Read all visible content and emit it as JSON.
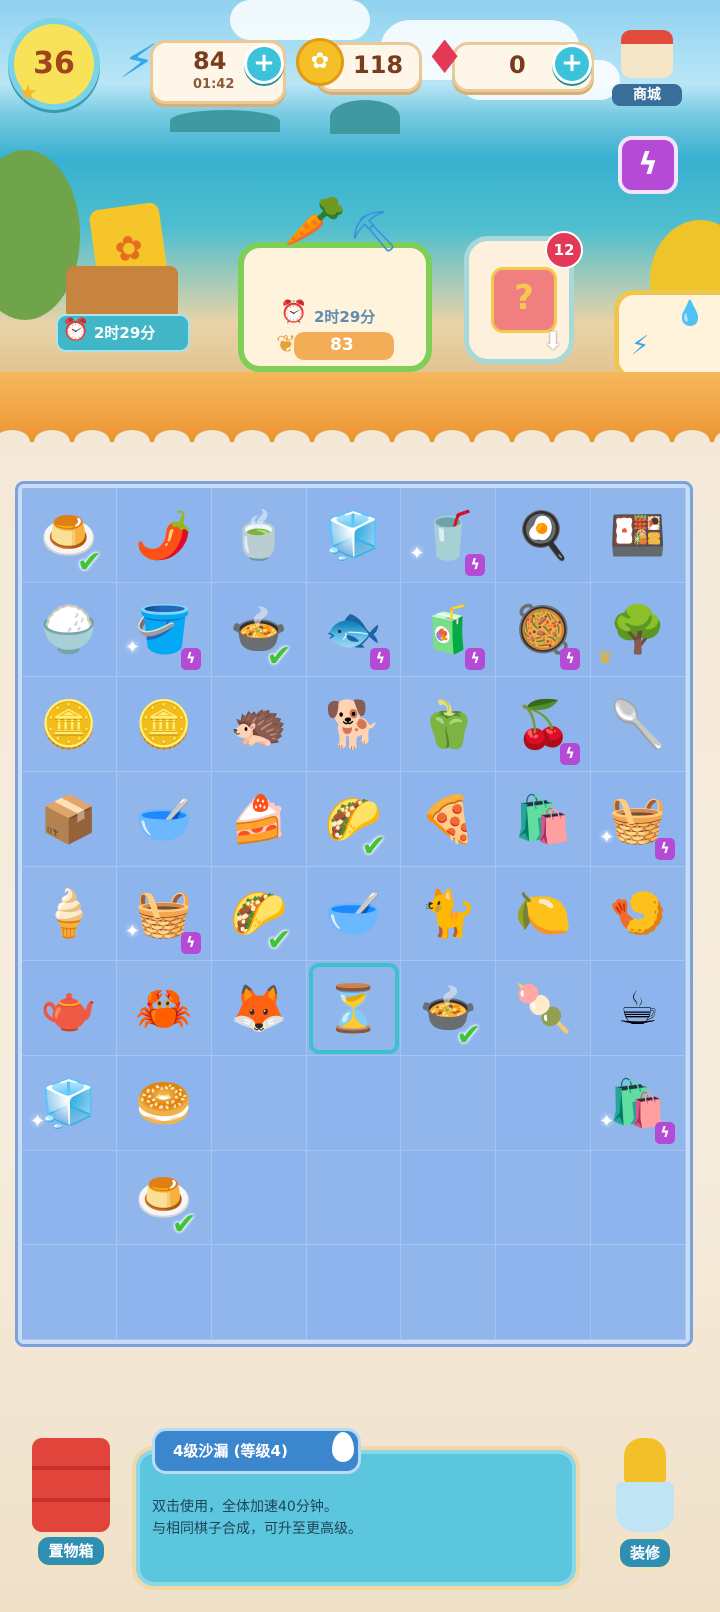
{
  "hud": {
    "level": "36",
    "energy_value": "84",
    "energy_timer": "01:42",
    "coins_value": "118",
    "gems_value": "0",
    "shop_label": "商城",
    "plus_symbol": "+"
  },
  "tasks": {
    "crate_timer": "2时29分",
    "garden_timer": "2时29分",
    "garden_count": "83",
    "chest_badge": "12"
  },
  "board": {
    "items": [
      {
        "icon": "🍮",
        "name": "steamed-bun",
        "check": true
      },
      {
        "icon": "🌶️",
        "name": "green-chili"
      },
      {
        "icon": "🍵",
        "name": "lemon-tea"
      },
      {
        "icon": "🧊",
        "name": "ice-box"
      },
      {
        "icon": "🥤",
        "name": "juicer",
        "sparkle": true,
        "bolt": true
      },
      {
        "icon": "🍳",
        "name": "frying-pan"
      },
      {
        "icon": "🍱",
        "name": "bento"
      },
      {
        "icon": "🍚",
        "name": "fried-rice"
      },
      {
        "icon": "🪣",
        "name": "bucket",
        "sparkle": true,
        "bolt": true
      },
      {
        "icon": "🍲",
        "name": "soup-bowl",
        "check": true
      },
      {
        "icon": "🐟",
        "name": "fish-bowl",
        "bolt": true
      },
      {
        "icon": "🧃",
        "name": "blender",
        "bolt": true
      },
      {
        "icon": "🥘",
        "name": "soup-pot",
        "bolt": true
      },
      {
        "icon": "🌳",
        "name": "tree",
        "crown": true
      },
      {
        "icon": "🪙",
        "name": "coin-pile-large"
      },
      {
        "icon": "🪙",
        "name": "coin-pile-small"
      },
      {
        "icon": "🦔",
        "name": "pangolin-statue"
      },
      {
        "icon": "🐕",
        "name": "dog-statue"
      },
      {
        "icon": "🫑",
        "name": "bell-pepper"
      },
      {
        "icon": "🍒",
        "name": "cherry-pan",
        "bolt": true
      },
      {
        "icon": "🥄",
        "name": "spatula"
      },
      {
        "icon": "📦",
        "name": "parcel"
      },
      {
        "icon": "🥣",
        "name": "flour-bowl"
      },
      {
        "icon": "🍰",
        "name": "pineapple-cake"
      },
      {
        "icon": "🌮",
        "name": "taco-plate",
        "check": true
      },
      {
        "icon": "🍕",
        "name": "pizza-plate"
      },
      {
        "icon": "🛍️",
        "name": "paper-bag"
      },
      {
        "icon": "🧺",
        "name": "corn-basket",
        "sparkle": true,
        "bolt": true
      },
      {
        "icon": "🍦",
        "name": "ice-cream"
      },
      {
        "icon": "🧺",
        "name": "cherry-basket",
        "sparkle": true,
        "bolt": true
      },
      {
        "icon": "🌮",
        "name": "taco-plate-2",
        "check": true
      },
      {
        "icon": "🥣",
        "name": "porcelain-bowl"
      },
      {
        "icon": "🐈",
        "name": "cat-statue"
      },
      {
        "icon": "🍋",
        "name": "citrus-juicer"
      },
      {
        "icon": "🍤",
        "name": "shrimp-dish"
      },
      {
        "icon": "🫖",
        "name": "green-kettle"
      },
      {
        "icon": "🦀",
        "name": "crab-dish"
      },
      {
        "icon": "🦊",
        "name": "fox-statue"
      },
      {
        "icon": "⏳",
        "name": "hourglass",
        "selected": true
      },
      {
        "icon": "🍲",
        "name": "soup-bowl-2",
        "check": true
      },
      {
        "icon": "🍡",
        "name": "ice-pop"
      },
      {
        "icon": "☕",
        "name": "tea-cup"
      },
      {
        "icon": "🧊",
        "name": "blue-fridge",
        "sparkle": true
      },
      {
        "icon": "🥯",
        "name": "sesame-bun"
      },
      {
        "icon": "",
        "name": "empty"
      },
      {
        "icon": "",
        "name": "empty"
      },
      {
        "icon": "",
        "name": "empty"
      },
      {
        "icon": "",
        "name": "empty"
      },
      {
        "icon": "🛍️",
        "name": "gift-bag",
        "sparkle": true,
        "bolt": true
      },
      {
        "icon": "",
        "name": "empty"
      },
      {
        "icon": "🍮",
        "name": "steamed-bun-2",
        "check": true
      },
      {
        "icon": "",
        "name": "empty"
      },
      {
        "icon": "",
        "name": "empty"
      },
      {
        "icon": "",
        "name": "empty"
      },
      {
        "icon": "",
        "name": "empty"
      },
      {
        "icon": "",
        "name": "empty"
      },
      {
        "icon": "",
        "name": "empty"
      },
      {
        "icon": "",
        "name": "empty"
      },
      {
        "icon": "",
        "name": "empty"
      },
      {
        "icon": "",
        "name": "empty"
      },
      {
        "icon": "",
        "name": "empty"
      },
      {
        "icon": "",
        "name": "empty"
      },
      {
        "icon": "",
        "name": "empty"
      }
    ]
  },
  "info": {
    "title": "4级沙漏 (等级4)",
    "description": "双击使用，全体加速40分钟。\n与相同棋子合成，可升至更高级。"
  },
  "buttons": {
    "storage_label": "置物箱",
    "decorate_label": "装修"
  },
  "colors": {
    "board": "#8db4ec",
    "accent_teal": "#3cc3d9",
    "check_green": "#41c43a",
    "bolt_purple": "#b44ad6"
  }
}
